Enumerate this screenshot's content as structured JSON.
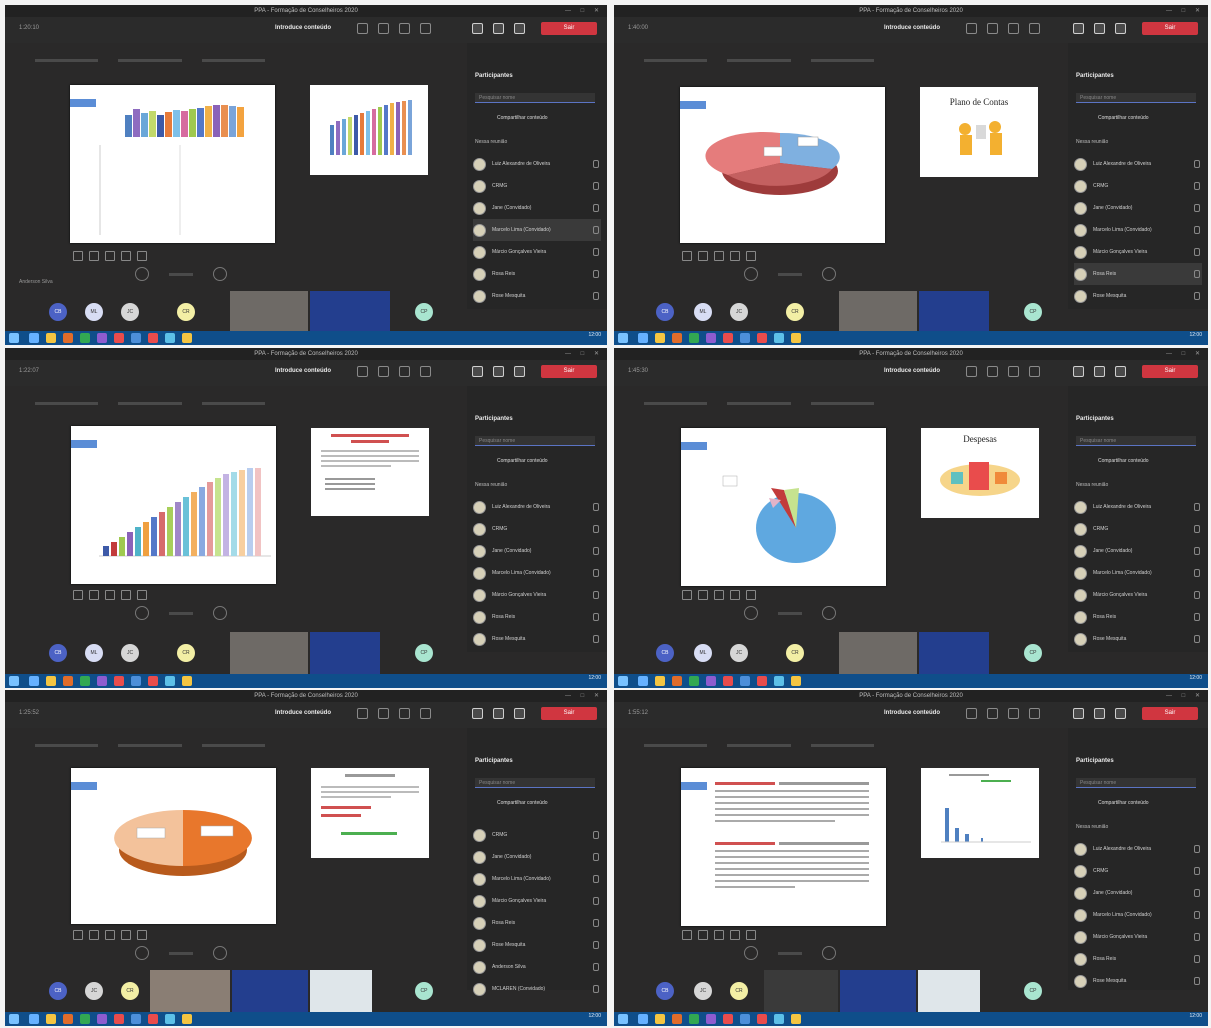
{
  "panels": [
    {
      "id": "p1",
      "main": "bars",
      "preview": "chart",
      "preview_title": ""
    },
    {
      "id": "p2",
      "main": "pie-red-blue",
      "preview": "illustration",
      "preview_title": "Plano de Contas"
    },
    {
      "id": "p3",
      "main": "bars-rising",
      "preview": "text",
      "preview_title": ""
    },
    {
      "id": "p4",
      "main": "pie-blue",
      "preview": "illustration2",
      "preview_title": "Despesas"
    },
    {
      "id": "p5",
      "main": "pie-orange",
      "preview": "text",
      "preview_title": ""
    },
    {
      "id": "p6",
      "main": "text",
      "preview": "chart-small",
      "preview_title": ""
    }
  ],
  "common": {
    "window_title": "PPA - Formação de Conselheiros 2020",
    "share_label": "Introduce conteúdo",
    "participants_title": "Participantes",
    "search_placeholder": "Pesquisar nome",
    "share_button": "Compartilhar conteúdo",
    "meeting_label": "Nessa reunião",
    "leave": "Sair",
    "clock": "12:00"
  },
  "colors": {
    "leave": "#d03640",
    "taskbar": "#0f4e8a",
    "bg": "#2a2929"
  }
}
